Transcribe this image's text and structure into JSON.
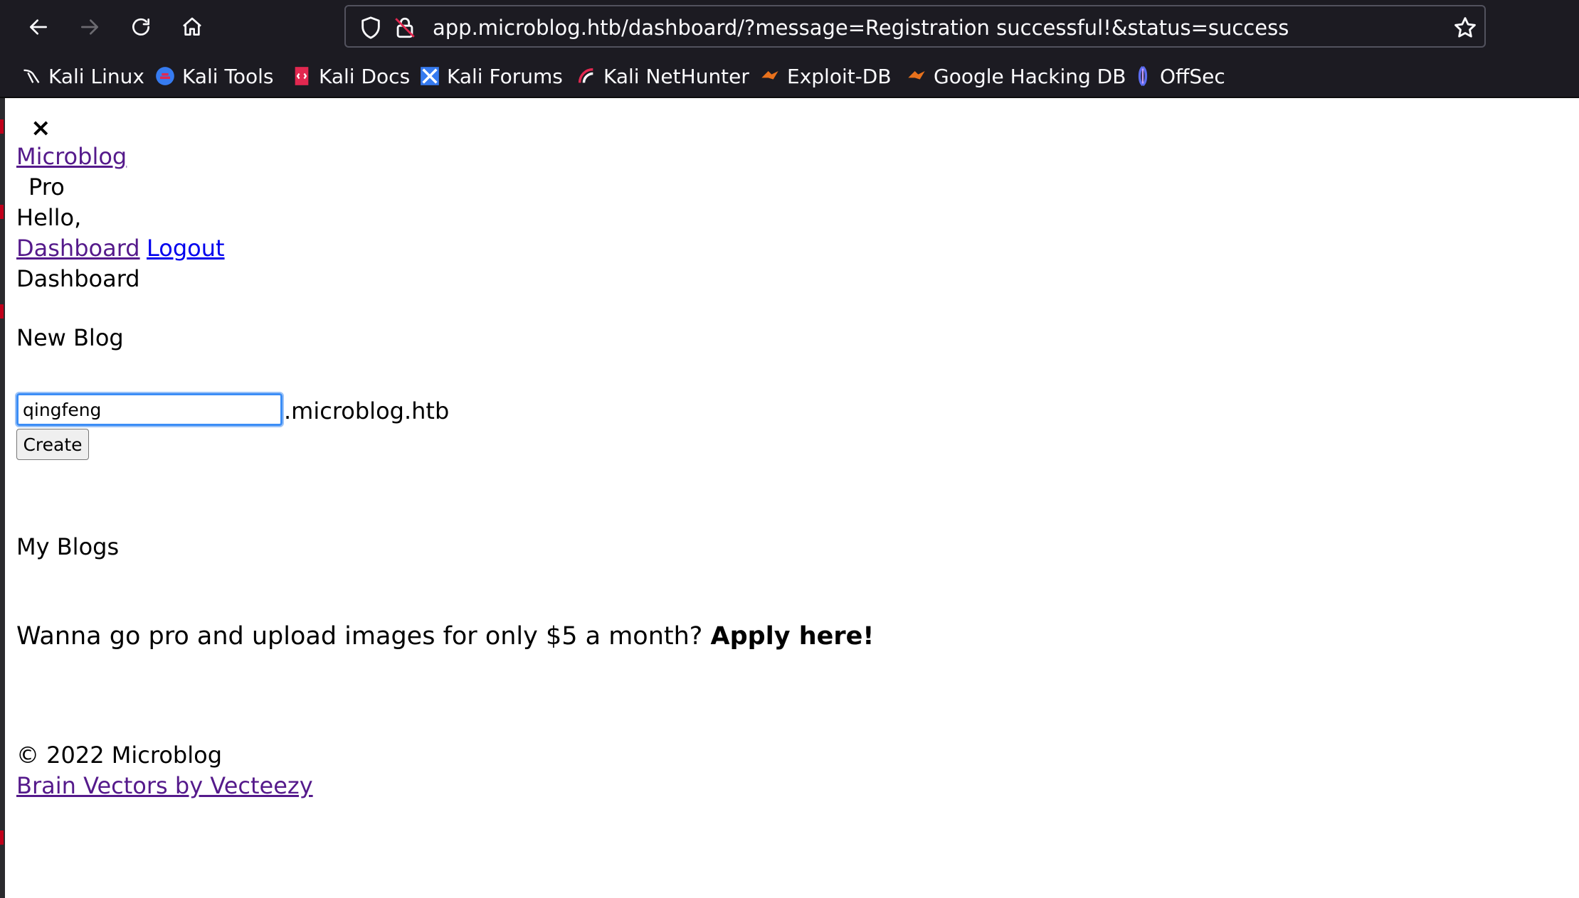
{
  "browser": {
    "url": "app.microblog.htb/dashboard/?message=Registration successful!&status=success",
    "bookmarks": [
      {
        "label": "Kali Linux",
        "icon": "kali-dragon-icon"
      },
      {
        "label": "Kali Tools",
        "icon": "kali-tools-icon"
      },
      {
        "label": "Kali Docs",
        "icon": "kali-docs-icon"
      },
      {
        "label": "Kali Forums",
        "icon": "kali-forums-icon"
      },
      {
        "label": "Kali NetHunter",
        "icon": "kali-nethunter-icon"
      },
      {
        "label": "Exploit-DB",
        "icon": "exploit-db-icon"
      },
      {
        "label": "Google Hacking DB",
        "icon": "google-hacking-db-icon"
      },
      {
        "label": "OffSec",
        "icon": "offsec-icon"
      }
    ]
  },
  "page": {
    "close": "×",
    "brand": "Microblog",
    "pro": "Pro",
    "greeting": "Hello,",
    "nav_dashboard": "Dashboard",
    "nav_logout": "Logout",
    "heading": "Dashboard",
    "new_blog_title": "New Blog",
    "blog_input_value": "qingfeng",
    "domain_suffix": ".microblog.htb",
    "create_label": "Create",
    "my_blogs_title": "My Blogs",
    "promo_text": "Wanna go pro and upload images for only $5 a month? ",
    "promo_link": "Apply here!",
    "copyright": "© 2022 Microblog",
    "credit_link": "Brain Vectors by Vecteezy"
  }
}
